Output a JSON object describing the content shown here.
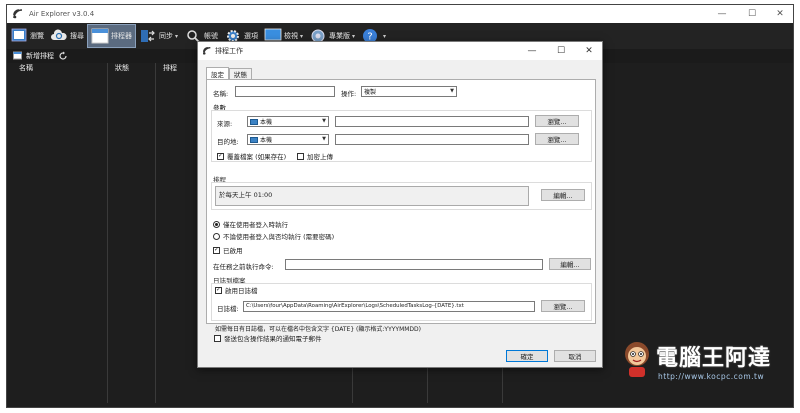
{
  "window": {
    "title": "Air Explorer v3.0.4",
    "min": "—",
    "max": "☐",
    "close": "✕"
  },
  "toolbar": [
    {
      "label": "瀏覽",
      "icon": "browse-icon",
      "dropdown": false,
      "active": false
    },
    {
      "label": "搜尋",
      "icon": "cloud-search-icon",
      "dropdown": false,
      "active": false
    },
    {
      "label": "排程器",
      "icon": "scheduler-icon",
      "dropdown": false,
      "active": true
    },
    {
      "label": "同步",
      "icon": "sync-icon",
      "dropdown": true,
      "active": false
    },
    {
      "label": "帳號",
      "icon": "account-icon",
      "dropdown": false,
      "active": false
    },
    {
      "label": "選項",
      "icon": "gear-icon",
      "dropdown": false,
      "active": false
    },
    {
      "label": "檢視",
      "icon": "monitor-icon",
      "dropdown": true,
      "active": false
    },
    {
      "label": "專業版",
      "icon": "pro-icon",
      "dropdown": true,
      "active": false
    },
    {
      "label": "",
      "icon": "help-icon",
      "dropdown": true,
      "active": false
    }
  ],
  "subbar": {
    "new_task": "新增排程"
  },
  "columns": [
    "名稱",
    "狀態",
    "排程"
  ],
  "dialog": {
    "title": "排程工作",
    "tabs": [
      "設定",
      "狀態"
    ],
    "name_label": "名稱:",
    "name_value": "",
    "operation_label": "操作:",
    "operation_value": "複製",
    "params_label": "參數",
    "source_label": "來源:",
    "source_value": "本機",
    "source_path": "",
    "dest_label": "目的地:",
    "dest_value": "本機",
    "dest_path": "",
    "browse": "瀏覽...",
    "overwrite_label": "覆蓋檔案 (如果存在)",
    "overwrite_checked": true,
    "encrypt_label": "加密上傳",
    "encrypt_checked": false,
    "schedule_label": "排程",
    "schedule_value": "於每天上午 01:00",
    "edit": "編輯...",
    "run_logged_on": "僅在使用者登入時執行",
    "run_always": "不論使用者登入與否均執行 (需要密碼)",
    "enabled_label": "已啟用",
    "enabled_checked": true,
    "pre_cmd_label": "在任務之前執行命令:",
    "pre_cmd_value": "",
    "log_group_label": "日誌到檔案",
    "enable_log_label": "啟用日誌檔",
    "enable_log_checked": true,
    "logfile_label": "日誌檔:",
    "logfile_value": "C:\\Users\\four\\AppData\\Roaming\\AirExplorer\\Logs\\ScheduledTasksLog-{DATE}.txt",
    "hint": "如需每日有日誌檔，可以在檔名中包含文字 {DATE} (顯示格式:YYYYMMDD)",
    "email_label": "發送包含操作結果的通知電子郵件",
    "email_checked": false,
    "ok": "確定",
    "cancel": "取消"
  },
  "watermark": {
    "text": "電腦王阿達",
    "url": "http://www.kocpc.com.tw"
  }
}
